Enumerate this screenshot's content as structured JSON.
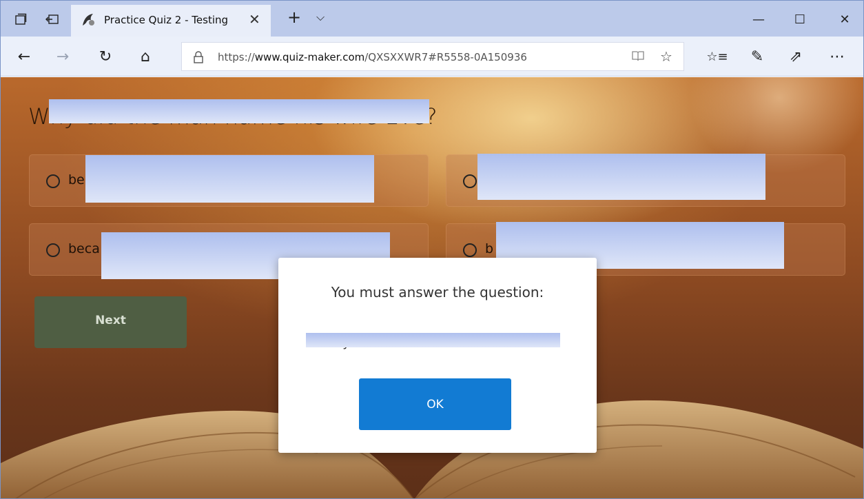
{
  "browser": {
    "tab_title": "Practice Quiz 2 - Testing",
    "url_prefix": "https://",
    "url_host": "www.quiz-maker.com",
    "url_path": "/QXSXXWR7#R5558-0A150936",
    "icons": {
      "tab_preview": "tab-preview-icon",
      "set_aside": "set-aside-icon",
      "favicon": "quiz-maker-favicon",
      "close_tab": "close-icon",
      "new_tab": "plus-icon",
      "tab_list": "chevron-down-icon",
      "back": "back-arrow-icon",
      "forward": "forward-arrow-icon",
      "refresh": "refresh-icon",
      "home": "home-icon",
      "lock": "lock-icon",
      "reading_view": "book-icon",
      "favorite": "star-icon",
      "favorites_hub": "favorites-list-icon",
      "web_note": "pen-icon",
      "share": "share-icon",
      "more": "more-icon"
    },
    "symbols": {
      "close": "✕",
      "new_tab": "+",
      "tab_list": "⌵",
      "minimize": "—",
      "maximize": "☐",
      "window_close": "✕",
      "back": "←",
      "forward": "→",
      "refresh": "↻",
      "home": "⌂",
      "reading_view": "📖",
      "favorite": "☆",
      "favorites_hub": "☆≡",
      "web_note": "✎",
      "share": "⇗",
      "more": "⋯"
    }
  },
  "quiz": {
    "question_partial": "Why did the man name his wife Eve?",
    "options": [
      {
        "visible_text": "be"
      },
      {
        "visible_text": ""
      },
      {
        "visible_text": "beca"
      },
      {
        "visible_text": "b"
      }
    ],
    "next_label": "Next"
  },
  "dialog": {
    "title": "You must answer the question:",
    "question_quote": "'Why did the man name his wife Eve?'",
    "ok_label": "OK"
  },
  "colors": {
    "tabbar_bg": "#bccaea",
    "navbar_bg": "#ebf0fa",
    "next_button": "#4f5e43",
    "ok_button": "#127bd3",
    "redaction": "#c5d2f2"
  }
}
